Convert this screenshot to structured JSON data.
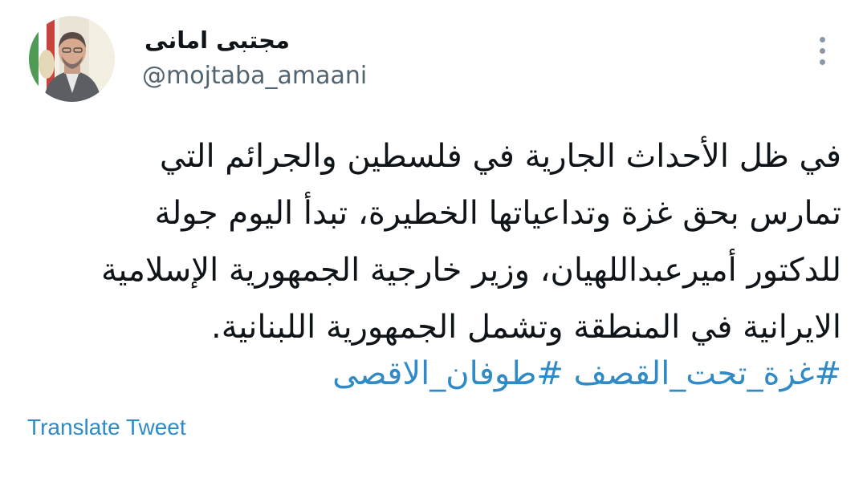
{
  "author": {
    "display_name": "مجتبی امانی",
    "handle": "@mojtaba_amaani",
    "avatar_icon": "profile-photo"
  },
  "more_icon": "more-vertical-icon",
  "tweet": {
    "lines": [
      "في ظل الأحداث الجارية في فلسطين والجرائم التي",
      "تمارس بحق غزة وتداعياتها الخطيرة، تبدأ اليوم جولة",
      "للدكتور أميرعبداللهيان، وزير خارجية الجمهورية الإسلامية",
      "الايرانية في المنطقة وتشمل الجمهورية اللبنانية."
    ],
    "hashtags": [
      "#غزة_تحت_القصف",
      "#طوفان_الاقصى"
    ]
  },
  "translate_label": "Translate Tweet",
  "colors": {
    "link": "#2f8ac6",
    "text": "#0f1419",
    "secondary": "#536471"
  }
}
